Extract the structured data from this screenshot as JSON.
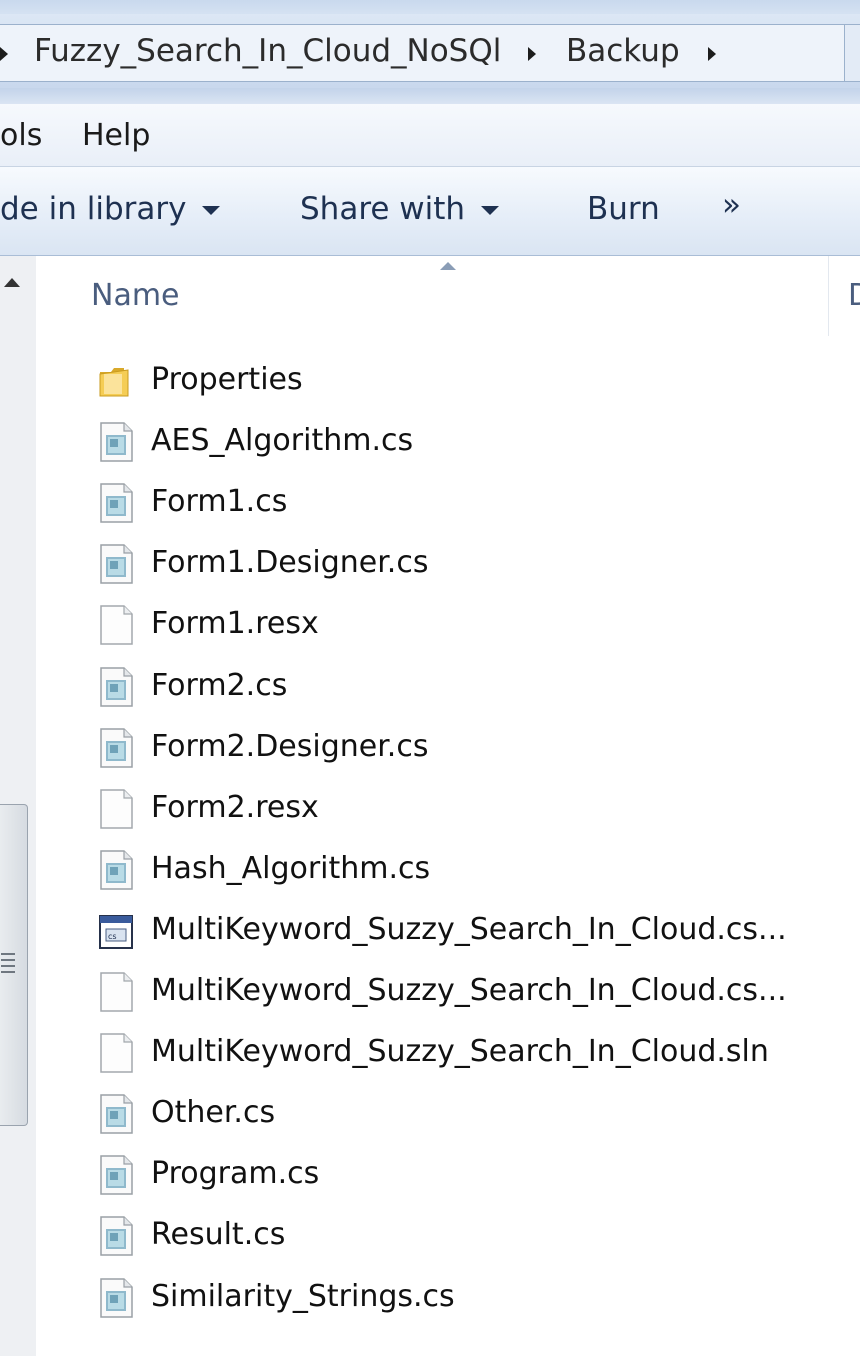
{
  "address": {
    "crumbs": [
      "Fuzzy_Search_In_Cloud_NoSQl",
      "Backup"
    ]
  },
  "menu": {
    "items": [
      "ols",
      "Help"
    ]
  },
  "toolbar": {
    "include_label": "de in library",
    "share_label": "Share with",
    "burn_label": "Burn",
    "more_label": "»"
  },
  "columns": {
    "name": "Name",
    "next": "D"
  },
  "files": [
    {
      "name": "Properties",
      "icon": "folder-icon"
    },
    {
      "name": "AES_Algorithm.cs",
      "icon": "cs-file-icon"
    },
    {
      "name": "Form1.cs",
      "icon": "cs-file-icon"
    },
    {
      "name": "Form1.Designer.cs",
      "icon": "cs-file-icon"
    },
    {
      "name": "Form1.resx",
      "icon": "blank-file-icon"
    },
    {
      "name": "Form2.cs",
      "icon": "cs-file-icon"
    },
    {
      "name": "Form2.Designer.cs",
      "icon": "cs-file-icon"
    },
    {
      "name": "Form2.resx",
      "icon": "blank-file-icon"
    },
    {
      "name": "Hash_Algorithm.cs",
      "icon": "cs-file-icon"
    },
    {
      "name": "MultiKeyword_Suzzy_Search_In_Cloud.cs...",
      "icon": "csproj-file-icon"
    },
    {
      "name": "MultiKeyword_Suzzy_Search_In_Cloud.cs...",
      "icon": "blank-file-icon"
    },
    {
      "name": "MultiKeyword_Suzzy_Search_In_Cloud.sln",
      "icon": "blank-file-icon"
    },
    {
      "name": "Other.cs",
      "icon": "cs-file-icon"
    },
    {
      "name": "Program.cs",
      "icon": "cs-file-icon"
    },
    {
      "name": "Result.cs",
      "icon": "cs-file-icon"
    },
    {
      "name": "Similarity_Strings.cs",
      "icon": "cs-file-icon"
    }
  ],
  "colors": {
    "accent": "#1e3151",
    "header_text": "#4a5d7e"
  }
}
